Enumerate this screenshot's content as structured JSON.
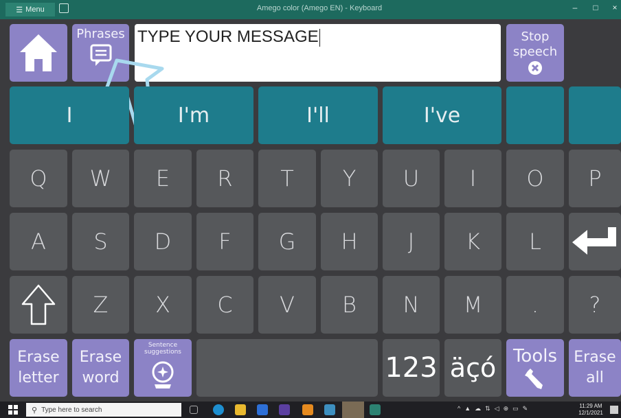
{
  "titlebar": {
    "menu_label": "Menu",
    "title": "Amego color (Amego EN) - Keyboard",
    "minimize": "–",
    "maximize": "□",
    "close": "×"
  },
  "top": {
    "phrases_label": "Phrases",
    "message_text": "TYPE YOUR MESSAGE",
    "stop_label_1": "Stop",
    "stop_label_2": "speech"
  },
  "predictions": [
    "I",
    "I'm",
    "I'll",
    "I've",
    "",
    ""
  ],
  "rows": {
    "row1": [
      "Q",
      "W",
      "E",
      "R",
      "T",
      "Y",
      "U",
      "I",
      "O",
      "P"
    ],
    "row2": [
      "A",
      "S",
      "D",
      "F",
      "G",
      "H",
      "J",
      "K",
      "L"
    ],
    "row3": [
      "Z",
      "X",
      "C",
      "V",
      "B",
      "N",
      "M",
      ".",
      "?"
    ]
  },
  "bottom": {
    "erase_letter_1": "Erase",
    "erase_letter_2": "letter",
    "erase_word_1": "Erase",
    "erase_word_2": "word",
    "sentence_1": "Sentence",
    "sentence_2": "suggestions",
    "numbers": "123",
    "accents": "äçó",
    "tools": "Tools",
    "erase_all_1": "Erase",
    "erase_all_2": "all"
  },
  "taskbar": {
    "search_placeholder": "Type here to search",
    "time": "11:29 AM",
    "date": "12/1/2021"
  },
  "colors": {
    "titlebar": "#1d6a5e",
    "grey_key": "#56585b",
    "purple_key": "#8c83c6",
    "teal_key": "#1e7c8c",
    "background": "#3b3b3e"
  }
}
